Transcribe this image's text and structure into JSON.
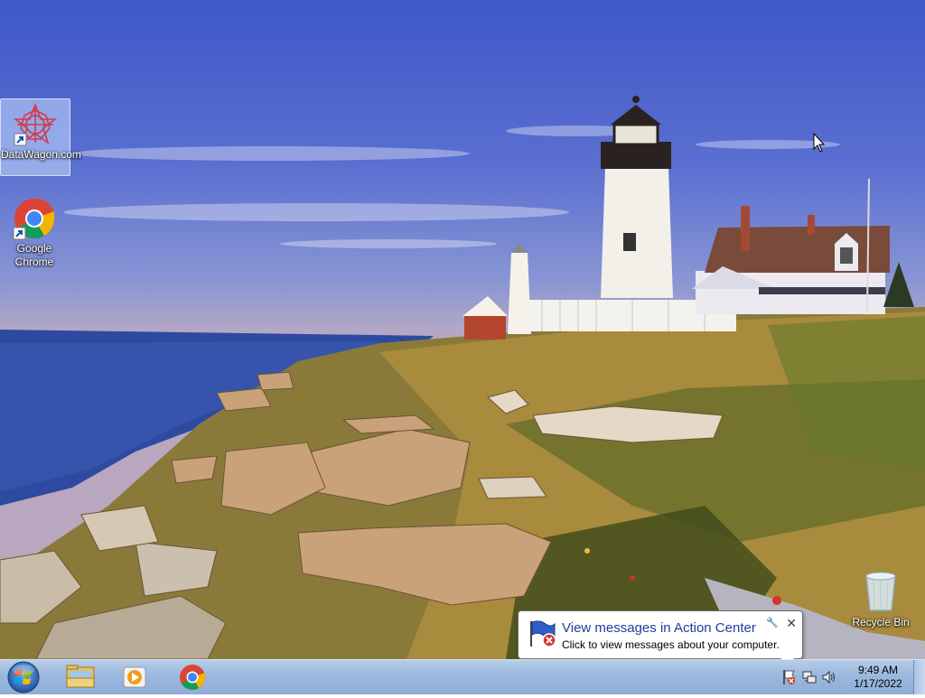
{
  "desktop": {
    "icons": [
      {
        "label": "DataWagon.com"
      },
      {
        "label": "Google Chrome"
      },
      {
        "label": "Recycle Bin"
      }
    ]
  },
  "balloon": {
    "title": "View messages in Action Center",
    "text": "Click to view messages about your computer."
  },
  "taskbar": {
    "pinned": [
      "windows-explorer-icon",
      "media-player-icon",
      "chrome-icon"
    ],
    "clock": {
      "time": "9:49 AM",
      "date": "1/17/2022"
    }
  },
  "colors": {
    "taskbar": "#9ab8de",
    "balloon_title": "#1e3f9a",
    "sky": "#3f58c9"
  }
}
